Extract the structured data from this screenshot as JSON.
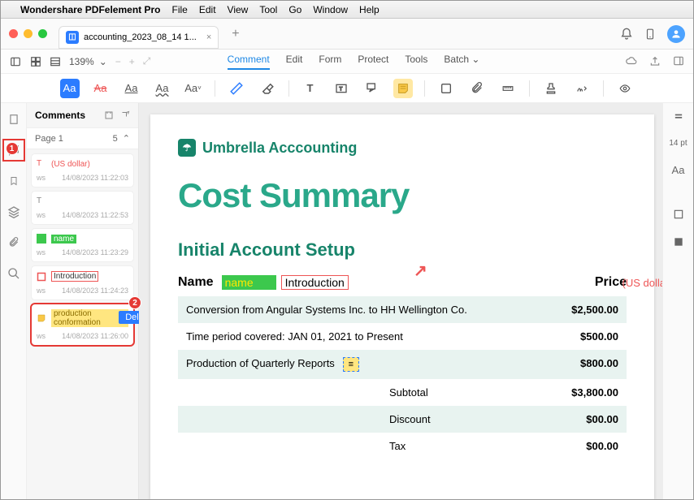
{
  "menubar": {
    "app": "Wondershare PDFelement Pro",
    "items": [
      "File",
      "Edit",
      "View",
      "Tool",
      "Go",
      "Window",
      "Help"
    ]
  },
  "tab": {
    "title": "accounting_2023_08_14 1...",
    "close": "×"
  },
  "toolbar": {
    "zoom": "139%",
    "tabs": [
      "Comment",
      "Edit",
      "Form",
      "Protect",
      "Tools",
      "Batch"
    ],
    "active": "Comment"
  },
  "badges": {
    "one": "1",
    "two": "2"
  },
  "comments": {
    "title": "Comments",
    "page_label": "Page 1",
    "count": "5",
    "items": [
      {
        "text": "(US dollar)",
        "author": "ws",
        "time": "14/08/2023 11:22:03",
        "kind": "text-red"
      },
      {
        "text": "",
        "author": "ws",
        "time": "14/08/2023 11:22:53",
        "kind": "text-plain"
      },
      {
        "text": "name",
        "author": "ws",
        "time": "14/08/2023 11:23:29",
        "kind": "hl-green"
      },
      {
        "text": "Introduction",
        "author": "ws",
        "time": "14/08/2023 11:24:23",
        "kind": "box-red"
      },
      {
        "text": "production conformation",
        "author": "ws",
        "time": "14/08/2023 11:26:00",
        "kind": "note"
      }
    ],
    "delete_label": "Delete"
  },
  "doc": {
    "brand": "Umbrella Acccounting",
    "title": "Cost Summary",
    "subtitle": "Initial Account Setup",
    "col_name": "Name",
    "col_price": "Price",
    "anno_name": "name",
    "anno_intro": "Introduction",
    "anno_usd": "(US dolla",
    "rows": [
      {
        "label": "Conversion from Angular Systems Inc. to HH Wellington Co.",
        "value": "$2,500.00"
      },
      {
        "label": "Time period covered: JAN 01, 2021 to Present",
        "value": "$500.00"
      },
      {
        "label": "Production of Quarterly Reports",
        "value": "$800.00",
        "note": true
      }
    ],
    "totals": [
      {
        "label": "Subtotal",
        "value": "$3,800.00"
      },
      {
        "label": "Discount",
        "value": "$00.00"
      },
      {
        "label": "Tax",
        "value": "$00.00"
      }
    ]
  },
  "rightrail": {
    "fontsize": "14 pt",
    "aa": "Aa"
  }
}
